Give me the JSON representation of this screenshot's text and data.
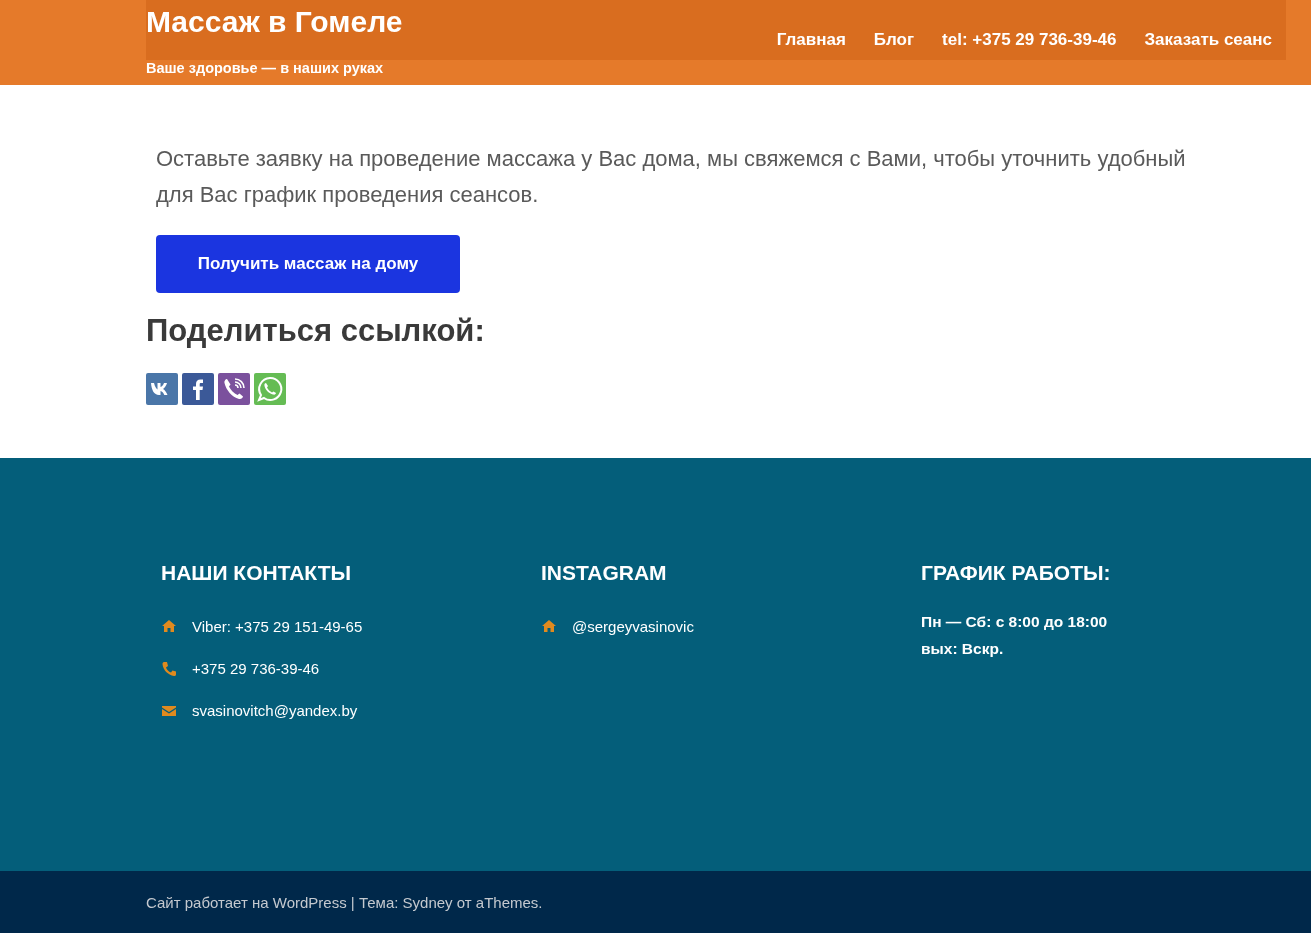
{
  "header": {
    "title": "Массаж в Гомеле",
    "tagline": "Ваше здоровье — в наших руках",
    "nav": [
      {
        "label": "Главная"
      },
      {
        "label": "Блог"
      },
      {
        "label": "tel: +375 29 736-39-46"
      },
      {
        "label": "Заказать сеанс"
      }
    ]
  },
  "content": {
    "text": "Оставьте заявку на проведение массажа у Вас дома, мы свяжемся с Вами, чтобы уточнить удобный для Вас график проведения сеансов.",
    "button": "Получить массаж на дому",
    "share_heading": "Поделиться ссылкой:",
    "share_buttons": [
      {
        "kind": "vk",
        "color": "#4a76a8"
      },
      {
        "kind": "facebook",
        "color": "#3b5998"
      },
      {
        "kind": "viber",
        "color": "#7b519d"
      },
      {
        "kind": "whatsapp",
        "color": "#65bc54"
      }
    ]
  },
  "footer": {
    "columns": [
      {
        "title": "НАШИ КОНТАКТЫ",
        "items": [
          {
            "kind": "home",
            "text": "Viber: +375 29 151-49-65"
          },
          {
            "kind": "phone",
            "text": "+375 29 736-39-46"
          },
          {
            "kind": "mail",
            "text": "svasinovitch@yandex.by"
          }
        ]
      },
      {
        "title": "INSTAGRAM",
        "items": [
          {
            "kind": "home",
            "text": "@sergeyvasinovic"
          }
        ]
      },
      {
        "title": "ГРАФИК РАБОТЫ:",
        "lines": [
          "Пн — Сб: с 8:00 до 18:00",
          "вых: Вскр."
        ]
      }
    ],
    "credits": "Сайт работает на WordPress | Тема: Sydney от aThemes."
  }
}
